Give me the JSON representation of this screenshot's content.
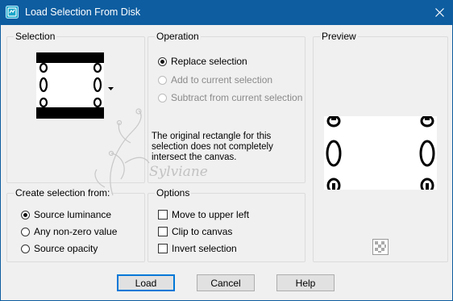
{
  "window": {
    "title": "Load Selection From Disk",
    "title_bar_color": "#0d5da0",
    "close_icon": "close-icon"
  },
  "selection_group": {
    "title": "Selection",
    "dropdown_icon": "dropdown-arrow-icon"
  },
  "operation_group": {
    "title": "Operation",
    "options": [
      {
        "label": "Replace selection",
        "checked": true,
        "enabled": true
      },
      {
        "label": "Add to current selection",
        "checked": false,
        "enabled": false
      },
      {
        "label": "Subtract from current selection",
        "checked": false,
        "enabled": false
      }
    ],
    "message": "The original rectangle for this selection does not completely intersect the canvas."
  },
  "preview_group": {
    "title": "Preview",
    "transparency_icon": "checkerboard-icon"
  },
  "create_group": {
    "title": "Create selection from:",
    "options": [
      {
        "label": "Source luminance",
        "checked": true
      },
      {
        "label": "Any non-zero value",
        "checked": false
      },
      {
        "label": "Source opacity",
        "checked": false
      }
    ]
  },
  "options_group": {
    "title": "Options",
    "checkboxes": [
      {
        "label": "Move to upper left",
        "checked": false
      },
      {
        "label": "Clip to canvas",
        "checked": false
      },
      {
        "label": "Invert selection",
        "checked": false
      }
    ]
  },
  "buttons": {
    "load": "Load",
    "cancel": "Cancel",
    "help": "Help"
  },
  "watermark_text": "Sylviane"
}
